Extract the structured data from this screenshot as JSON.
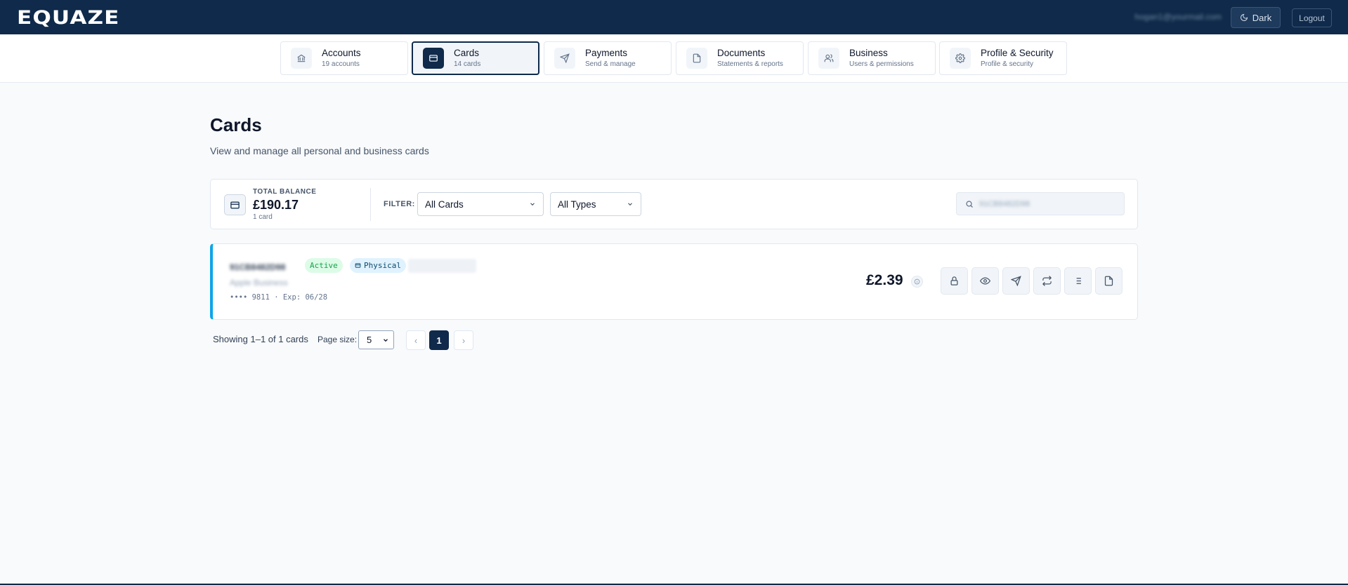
{
  "header": {
    "logo": "EQUAZE",
    "user_email": "hogan1@yourmail.com",
    "dark_label": "Dark",
    "logout_label": "Logout"
  },
  "nav": [
    {
      "label": "Accounts",
      "sub": "19 accounts",
      "icon": "bank-icon",
      "active": false
    },
    {
      "label": "Cards",
      "sub": "14 cards",
      "icon": "card-icon",
      "active": true
    },
    {
      "label": "Payments",
      "sub": "Send & manage",
      "icon": "send-icon",
      "active": false
    },
    {
      "label": "Documents",
      "sub": "Statements & reports",
      "icon": "document-icon",
      "active": false
    },
    {
      "label": "Business",
      "sub": "Users & permissions",
      "icon": "users-icon",
      "active": false
    },
    {
      "label": "Profile & Security",
      "sub": "Profile & security",
      "icon": "gear-icon",
      "active": false
    }
  ],
  "page": {
    "title": "Cards",
    "subtitle": "View and manage all personal and business cards"
  },
  "summary": {
    "balance_label": "TOTAL BALANCE",
    "balance_value": "£190.17",
    "card_count": "1 card",
    "filter_label": "FILTER:",
    "filter_cards": "All Cards",
    "filter_types": "All Types",
    "search_value": "91CB8482D98"
  },
  "card": {
    "id": "91CB8482D98",
    "status": "Active",
    "type": "Physical",
    "holder": "Apple Business",
    "meta": "•••• 9811 · Exp: 06/28",
    "amount": "£2.39",
    "accent_color": "#0ea5e9",
    "actions": [
      "lock-icon",
      "eye-icon",
      "send-icon",
      "transfer-icon",
      "list-icon",
      "document-icon"
    ]
  },
  "pagination": {
    "showing": "Showing 1–1 of 1 cards",
    "page_size_label": "Page size:",
    "page_size": "5",
    "prev": "‹",
    "current_page": "1",
    "next": "›"
  },
  "colors": {
    "primary": "#0f2a4a",
    "active_badge_bg": "#dcfce7",
    "active_badge_text": "#16a34a",
    "physical_badge_bg": "#e0f2fe"
  }
}
